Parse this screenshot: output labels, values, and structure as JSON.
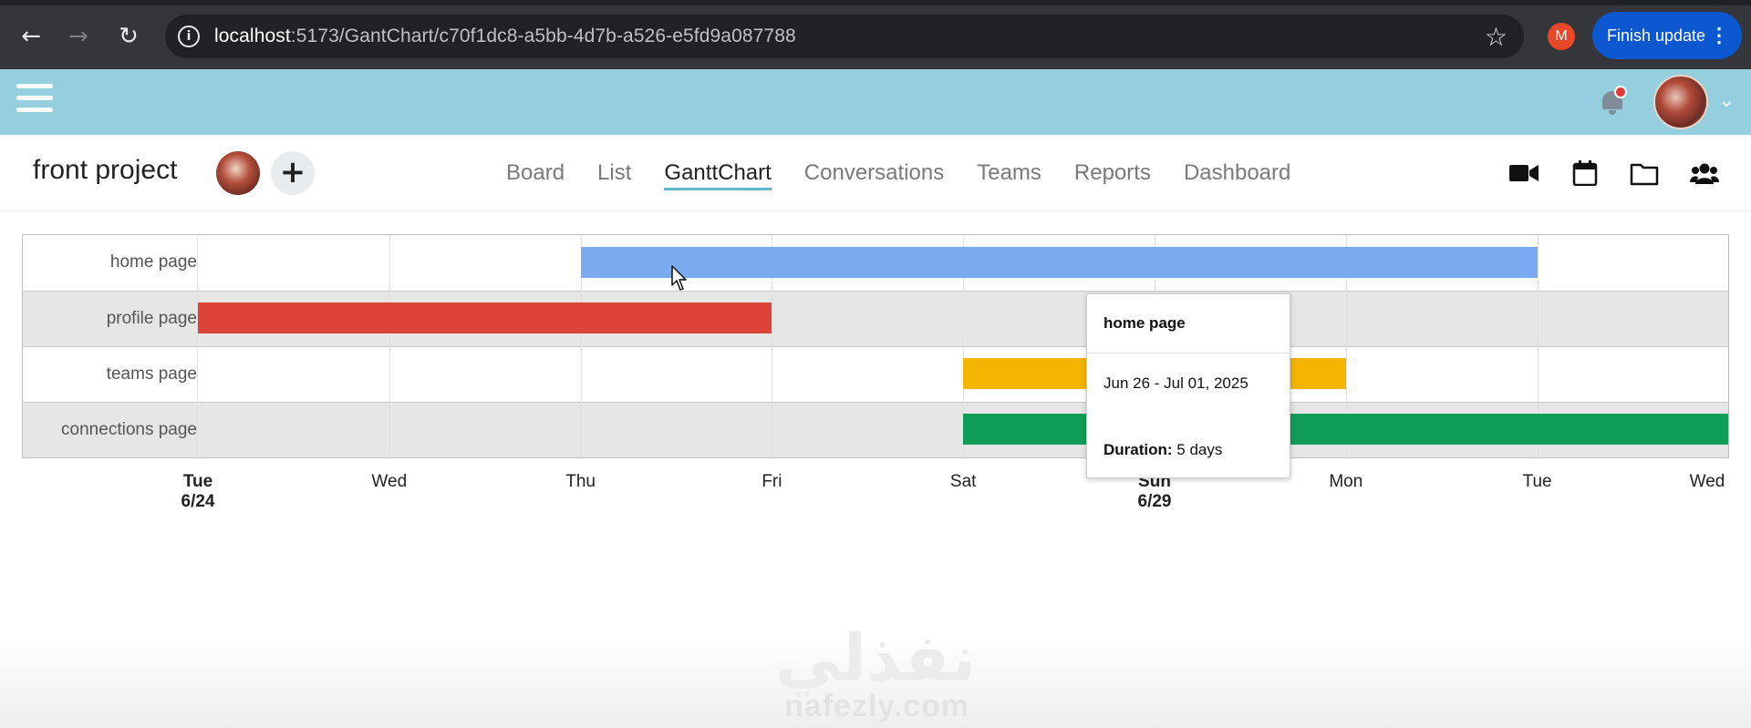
{
  "browser": {
    "url_host": "localhost",
    "url_path": ":5173/GantChart/c70f1dc8-a5bb-4d7b-a526-e5fd9a087788",
    "profile_initial": "M",
    "finish_update_label": "Finish update",
    "menu_dots": "⋮"
  },
  "project": {
    "title": "front project"
  },
  "tabs": [
    {
      "label": "Board",
      "active": false
    },
    {
      "label": "List",
      "active": false
    },
    {
      "label": "GanttChart",
      "active": true
    },
    {
      "label": "Conversations",
      "active": false
    },
    {
      "label": "Teams",
      "active": false
    },
    {
      "label": "Reports",
      "active": false
    },
    {
      "label": "Dashboard",
      "active": false
    }
  ],
  "toolbar_icons": [
    "video-camera-icon",
    "calendar-icon",
    "folder-icon",
    "users-icon"
  ],
  "chart_data": {
    "type": "gantt",
    "axis_ticks": [
      {
        "day": "Tue",
        "date": "6/24"
      },
      {
        "day": "Wed",
        "date": ""
      },
      {
        "day": "Thu",
        "date": ""
      },
      {
        "day": "Fri",
        "date": ""
      },
      {
        "day": "Sat",
        "date": ""
      },
      {
        "day": "Sun",
        "date": "6/29"
      },
      {
        "day": "Mon",
        "date": ""
      },
      {
        "day": "Tue",
        "date": ""
      },
      {
        "day": "Wed",
        "date": ""
      }
    ],
    "tasks": [
      {
        "name": "home page",
        "start": "2025-06-26",
        "end": "2025-07-01",
        "color": "#7baaf0"
      },
      {
        "name": "profile page",
        "start": "2025-06-24",
        "end": "2025-06-27",
        "color": "#db4437"
      },
      {
        "name": "teams page",
        "start": "2025-06-28",
        "end": "2025-06-30",
        "color": "#f4b400"
      },
      {
        "name": "connections page",
        "start": "2025-06-28",
        "end": "2025-07-02",
        "color": "#0f9d58"
      }
    ]
  },
  "tooltip": {
    "title": "home page",
    "range": "Jun 26 - Jul 01, 2025",
    "duration_label": "Duration:",
    "duration_value": "5 days"
  },
  "watermark": {
    "arabic": "نفذلي",
    "text": "nafezly.com"
  }
}
